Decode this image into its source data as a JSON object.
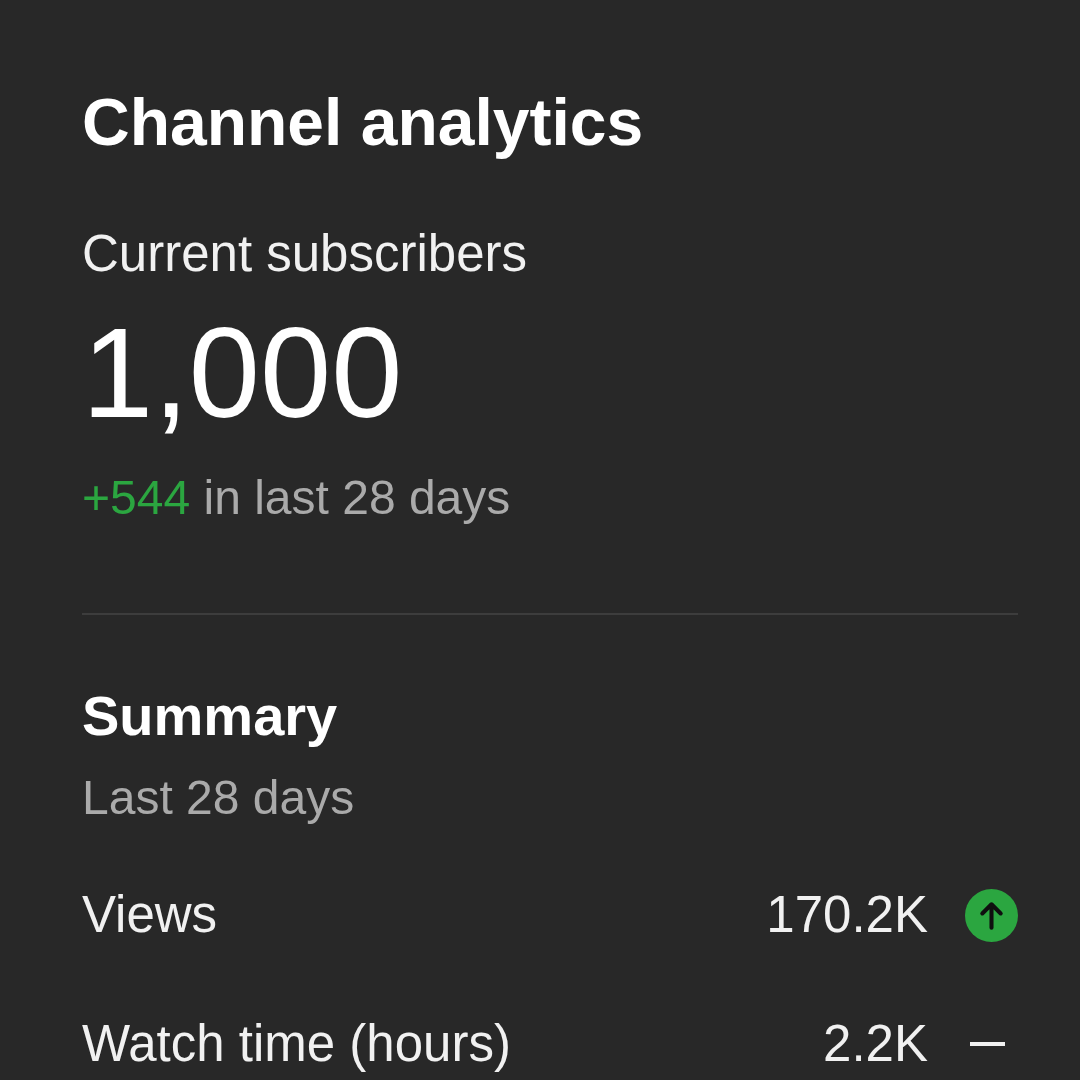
{
  "title": "Channel analytics",
  "subscribers": {
    "label": "Current subscribers",
    "count": "1,000",
    "change": {
      "value": "+544",
      "positive": true,
      "text": "in last 28 days"
    }
  },
  "summary": {
    "title": "Summary",
    "period": "Last 28 days",
    "metrics": [
      {
        "label": "Views",
        "value": "170.2K",
        "kind": "up"
      },
      {
        "label": "Watch time (hours)",
        "value": "2.2K",
        "kind": "flat"
      }
    ]
  }
}
